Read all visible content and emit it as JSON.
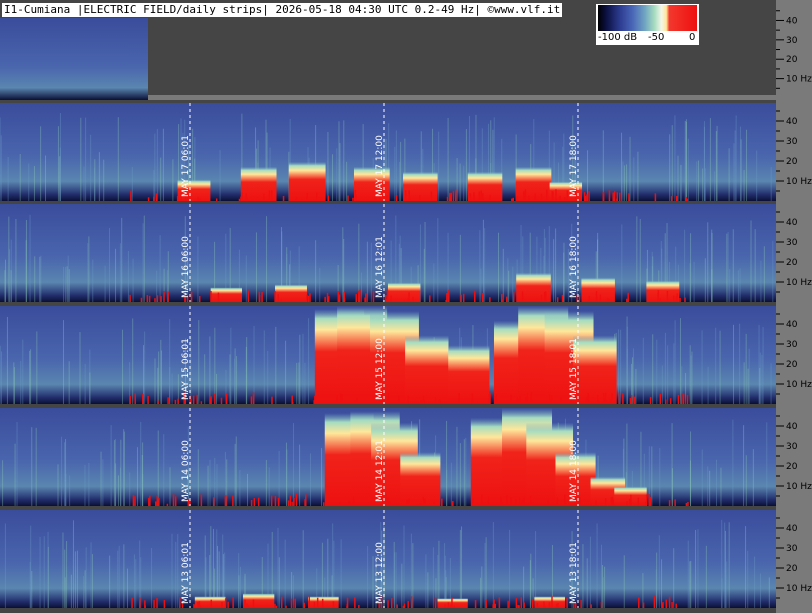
{
  "header": {
    "title": "I1-Cumiana |ELECTRIC FIELD/daily strips| 2026-05-18 04:30 UTC 0.2-49 Hz| ©www.vlf.it"
  },
  "colorbar": {
    "labels": [
      "-100 dB",
      "-50",
      "0"
    ],
    "colors": [
      "#000000",
      "#2c3b8f",
      "#6fa3c2",
      "#a6dcc0",
      "#f3f6e8",
      "#ffe79a",
      "#ee1010"
    ]
  },
  "chart_data": {
    "type": "heatmap",
    "title": "I1-Cumiana |ELECTRIC FIELD/daily strips| 2026-05-18 04:30 UTC 0.2-49 Hz| ©www.vlf.it",
    "ylabel_unit": "Hz",
    "y_tick_labels": [
      "40",
      "30",
      "20",
      "10 Hz"
    ],
    "y_ticks_hz": [
      40,
      30,
      20,
      10
    ],
    "ylim": [
      0.2,
      49
    ],
    "colorscale_db": [
      -100,
      0
    ],
    "strips": [
      {
        "date": "MAY 17",
        "markers": [
          "MAY 17  06:01",
          "MAY 17  12:00",
          "MAY 17  18:00"
        ],
        "marker_hours": [
          6,
          12,
          18
        ],
        "bursts": [
          [
            6.0,
            0.22
          ],
          [
            8.0,
            0.35
          ],
          [
            9.5,
            0.4
          ],
          [
            11.5,
            0.35
          ],
          [
            13.0,
            0.3
          ],
          [
            15.0,
            0.3
          ],
          [
            16.5,
            0.35
          ],
          [
            17.5,
            0.2
          ]
        ]
      },
      {
        "date": "MAY 16",
        "markers": [
          "MAY 16  06:00",
          "MAY 16  12:01",
          "MAY 16  18:00"
        ],
        "marker_hours": [
          6,
          12,
          18
        ],
        "bursts": [
          [
            7.0,
            0.15
          ],
          [
            9.0,
            0.18
          ],
          [
            12.5,
            0.2
          ],
          [
            16.5,
            0.3
          ],
          [
            18.5,
            0.25
          ],
          [
            20.5,
            0.22
          ]
        ]
      },
      {
        "date": "MAY 15",
        "markers": [
          "MAY 15  06:01",
          "MAY 15  12:00",
          "MAY 15  18:01"
        ],
        "marker_hours": [
          6,
          12,
          18
        ],
        "bursts": [
          [
            10.5,
            0.97
          ],
          [
            11.2,
            1.0
          ],
          [
            12.2,
            0.95
          ],
          [
            13.2,
            0.7
          ],
          [
            14.5,
            0.6
          ],
          [
            16.0,
            0.85
          ],
          [
            16.8,
            1.0
          ],
          [
            17.6,
            0.95
          ],
          [
            18.4,
            0.7
          ]
        ]
      },
      {
        "date": "MAY 14",
        "markers": [
          "MAY 14  06:00",
          "MAY 14  12:01",
          "MAY 14  18:00"
        ],
        "marker_hours": [
          6,
          12,
          18
        ],
        "bursts": [
          [
            10.8,
            0.95
          ],
          [
            11.6,
            0.97
          ],
          [
            12.2,
            0.85
          ],
          [
            13.0,
            0.55
          ],
          [
            15.3,
            0.9
          ],
          [
            16.3,
            1.0
          ],
          [
            17.0,
            0.85
          ],
          [
            17.8,
            0.55
          ],
          [
            18.8,
            0.3
          ],
          [
            19.5,
            0.2
          ]
        ]
      },
      {
        "date": "MAY 13",
        "markers": [
          "MAY 13  06:01",
          "MAY 13  12:00",
          "MAY 13  18:01"
        ],
        "marker_hours": [
          6,
          12,
          18
        ],
        "bursts": [
          [
            6.5,
            0.12
          ],
          [
            8.0,
            0.15
          ],
          [
            10.0,
            0.12
          ],
          [
            14.0,
            0.1
          ],
          [
            17.0,
            0.12
          ]
        ]
      }
    ]
  }
}
